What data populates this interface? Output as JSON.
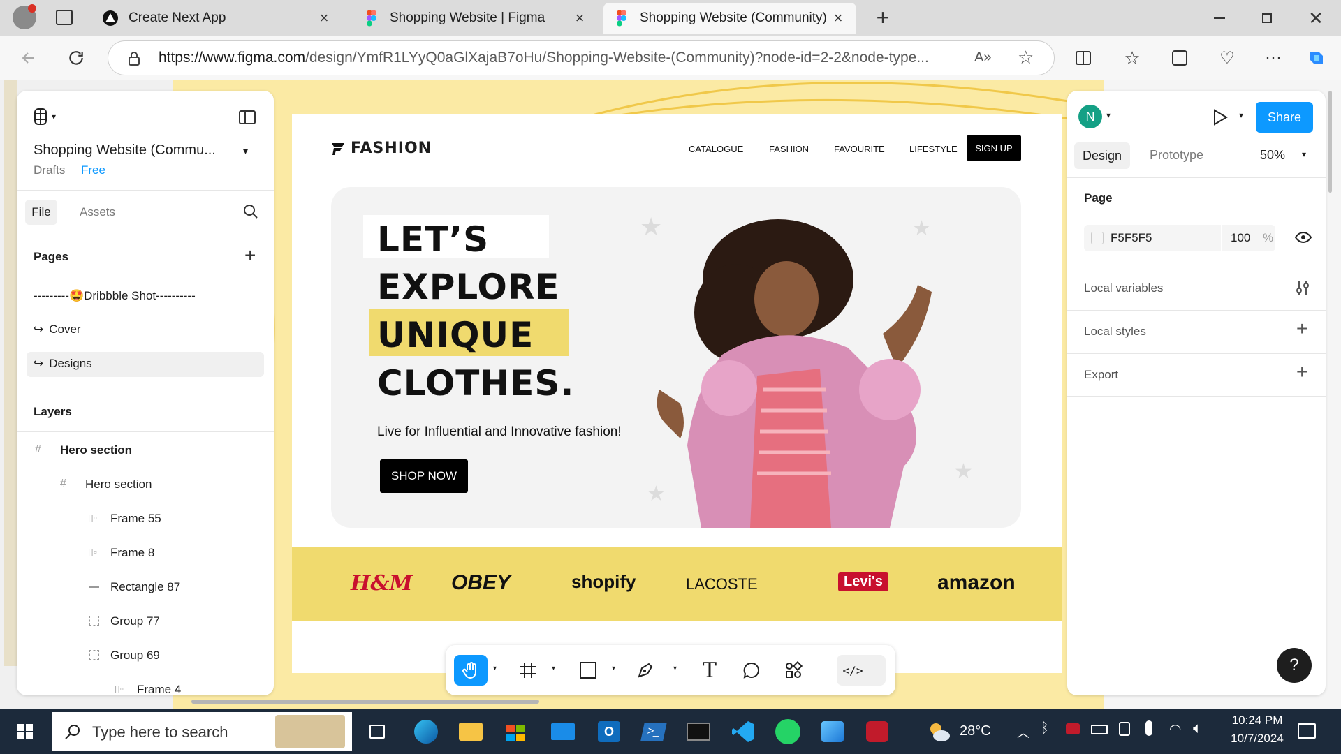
{
  "browser": {
    "tabs": [
      {
        "title": "Create Next App",
        "active": false
      },
      {
        "title": "Shopping Website | Figma",
        "active": false
      },
      {
        "title": "Shopping Website (Community) -",
        "active": true
      }
    ],
    "url_domain": "https://www.figma.com",
    "url_path": "/design/YmfR1LYyQ0aGlXajaB7oHu/Shopping-Website-(Community)?node-id=2-2&node-type..."
  },
  "figma": {
    "file_name": "Shopping Website (Commu...",
    "drafts_label": "Drafts",
    "plan_label": "Free",
    "tabs": {
      "file": "File",
      "assets": "Assets"
    },
    "pages_heading": "Pages",
    "pages": [
      {
        "label": "---------🤩Dribbble Shot----------"
      },
      {
        "label": "Cover"
      },
      {
        "label": "Designs"
      }
    ],
    "layers_heading": "Layers",
    "layers": [
      {
        "label": "Hero section"
      },
      {
        "label": "Hero section"
      },
      {
        "label": "Frame 55"
      },
      {
        "label": "Frame 8"
      },
      {
        "label": "Rectangle 87"
      },
      {
        "label": "Group 77"
      },
      {
        "label": "Group 69"
      },
      {
        "label": "Frame 4"
      }
    ],
    "right": {
      "avatar_letter": "N",
      "share_label": "Share",
      "tab_design": "Design",
      "tab_prototype": "Prototype",
      "zoom": "50%",
      "page_heading": "Page",
      "page_color": "F5F5F5",
      "page_opacity": "100",
      "percent": "%",
      "local_variables": "Local variables",
      "local_styles": "Local styles",
      "export": "Export",
      "help": "?"
    }
  },
  "design": {
    "logo": "FASHION",
    "nav": [
      "CATALOGUE",
      "FASHION",
      "FAVOURITE",
      "LIFESTYLE"
    ],
    "signup": "SIGN UP",
    "headline": [
      "LET’S",
      "EXPLORE",
      "UNIQUE",
      "CLOTHES."
    ],
    "tagline": "Live for Influential and Innovative fashion!",
    "cta": "SHOP NOW",
    "brands": [
      "H&M",
      "OBEY",
      "shopify",
      "LACOSTE",
      "Levi's",
      "amazon"
    ]
  },
  "taskbar": {
    "search_placeholder": "Type here to search",
    "temperature": "28°C",
    "time": "10:24 PM",
    "date": "10/7/2024"
  },
  "colors": {
    "share_blue": "#0d99ff",
    "hero_yellow": "#f0da6e",
    "canvas_yellow": "#fbeaa4",
    "taskbar": "#1c2a3b"
  }
}
